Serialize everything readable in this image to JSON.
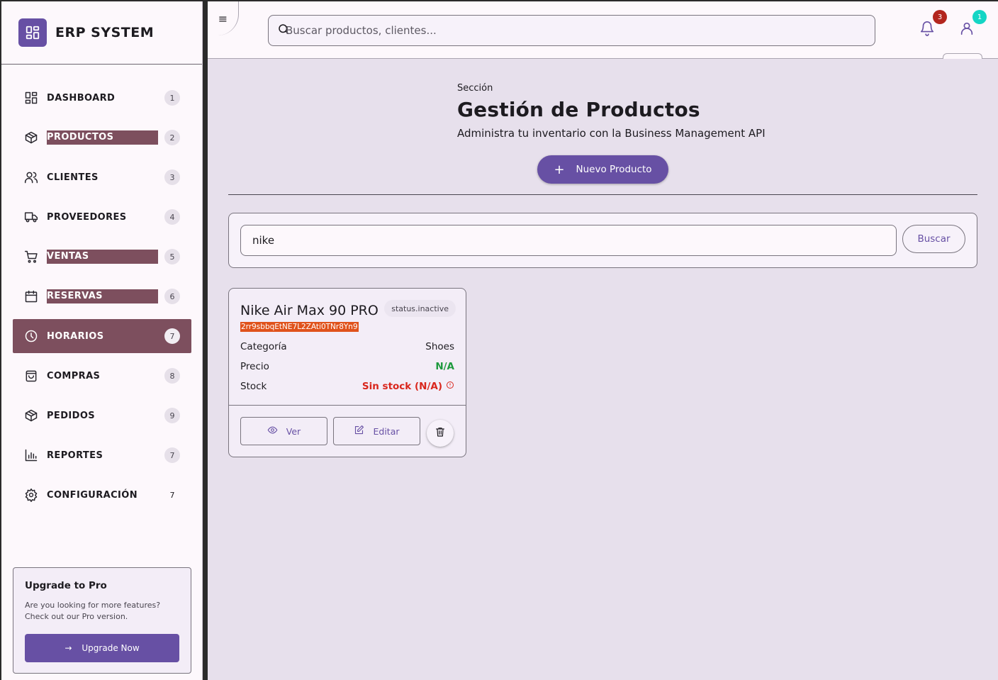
{
  "brand": {
    "title": "ERP SYSTEM",
    "logo_icon": "grid-icon",
    "accent": "#6750a4"
  },
  "sidebar": {
    "items": [
      {
        "label": "DASHBOARD",
        "badge": "1",
        "icon": "dashboard-icon"
      },
      {
        "label": "PRODUCTOS",
        "badge": "2",
        "icon": "box-icon"
      },
      {
        "label": "CLIENTES",
        "badge": "3",
        "icon": "users-icon"
      },
      {
        "label": "PROVEEDORES",
        "badge": "4",
        "icon": "truck-icon"
      },
      {
        "label": "VENTAS",
        "badge": "5",
        "icon": "cart-icon"
      },
      {
        "label": "RESERVAS",
        "badge": "6",
        "icon": "calendar-icon"
      },
      {
        "label": "HORARIOS",
        "badge": "7",
        "icon": "clock-icon"
      },
      {
        "label": "COMPRAS",
        "badge": "8",
        "icon": "bag-icon"
      },
      {
        "label": "PEDIDOS",
        "badge": "9",
        "icon": "box-icon"
      },
      {
        "label": "REPORTES",
        "badge": "7",
        "icon": "bar-chart-icon"
      },
      {
        "label": "CONFIGURACIÓN",
        "badge": "7",
        "icon": "gear-icon"
      }
    ],
    "active": "HORARIOS",
    "highlight_color": "#7d4f5e"
  },
  "upgrade": {
    "title": "Upgrade to Pro",
    "text": "Are you looking for more features? Check out our Pro version.",
    "button": "Upgrade Now",
    "button_arrow": "→"
  },
  "topbar": {
    "menu_glyph": "≡",
    "search_placeholder": "Buscar productos, clientes...",
    "notifications_count": "3",
    "user_count": "1"
  },
  "page": {
    "section_label": "Sección",
    "title": "Gestión de Productos",
    "subtitle": "Administra tu inventario con la Business Management API",
    "new_button": "Nuevo Producto",
    "new_button_glyph": "+"
  },
  "filter": {
    "value": "nike",
    "button": "Buscar"
  },
  "product": {
    "name": "Nike Air Max 90 PRO",
    "status": "status.inactive",
    "id": "2rr9sbbqEtNE7L2ZAti0TNr8Yn9",
    "rows": [
      {
        "label": "Categoría",
        "value": "Shoes"
      },
      {
        "label": "Precio",
        "value": "N/A"
      },
      {
        "label": "Stock",
        "value": "Sin stock (N/A)"
      }
    ],
    "view_button": "Ver",
    "edit_button": "Editar"
  }
}
